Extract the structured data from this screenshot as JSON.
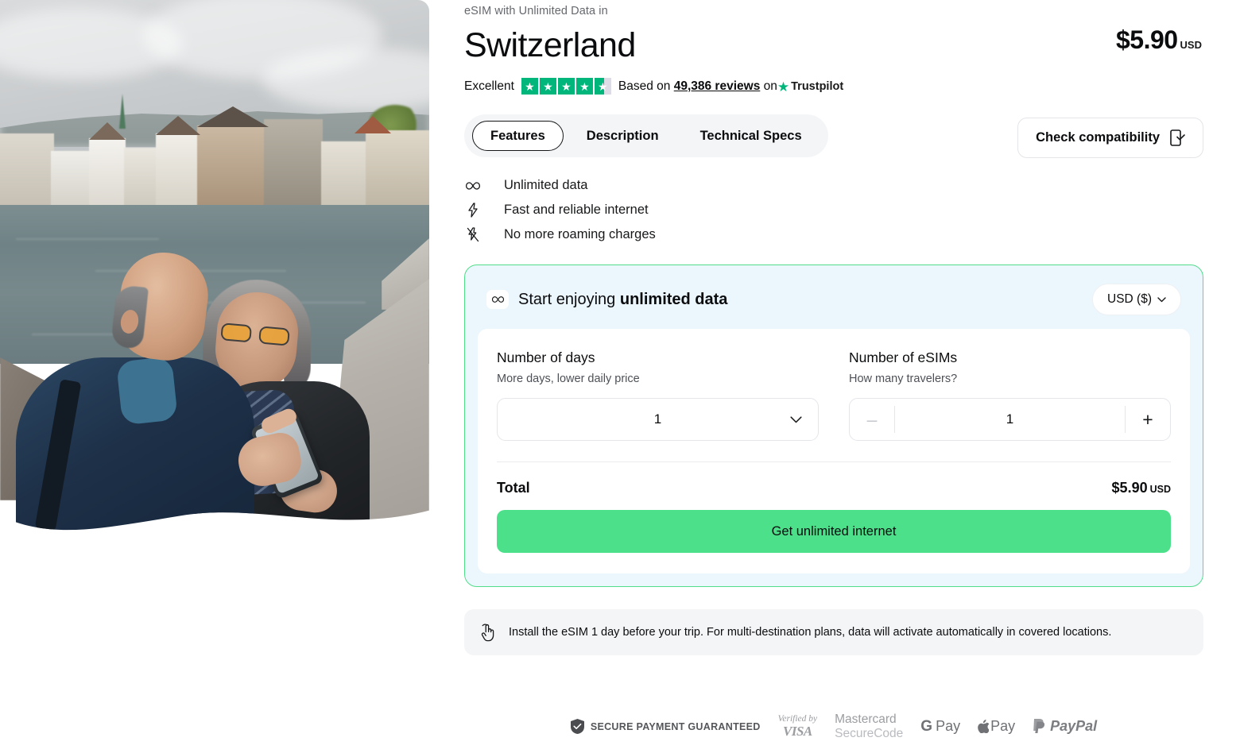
{
  "hero": {
    "alt": "Senior couple looking at a smartphone by the Limmat river in Zurich, Switzerland"
  },
  "header": {
    "eyebrow": "eSIM with Unlimited Data in",
    "title": "Switzerland",
    "price": "$5.90",
    "price_currency": "USD"
  },
  "rating": {
    "label": "Excellent",
    "stars_total": 5,
    "stars_filled": 4.6,
    "based_prefix": "Based on",
    "reviews": "49,386 reviews",
    "on": "on",
    "provider": "Trustpilot",
    "star_color": "#00b67a"
  },
  "tabs": [
    {
      "label": "Features",
      "active": true
    },
    {
      "label": "Description",
      "active": false
    },
    {
      "label": "Technical Specs",
      "active": false
    }
  ],
  "check_compatibility": {
    "label": "Check compatibility",
    "icon": "phone-check-icon"
  },
  "features": [
    {
      "icon": "infinity-icon",
      "label": "Unlimited data"
    },
    {
      "icon": "bolt-icon",
      "label": "Fast and reliable internet"
    },
    {
      "icon": "bolt-slash-icon",
      "label": "No more roaming charges"
    }
  ],
  "buy": {
    "heading_prefix": "Start enjoying ",
    "heading_bold": "unlimited data",
    "heading_icon": "infinity-icon",
    "currency_selected": "USD ($)",
    "border_color": "#52dd8a",
    "background_color": "#ecf6fd",
    "days": {
      "title": "Number of days",
      "subtitle": "More days, lower daily price",
      "value": "1"
    },
    "esims": {
      "title": "Number of eSIMs",
      "subtitle": "How many travelers?",
      "value": "1",
      "minus": "–",
      "plus": "+",
      "minus_disabled": true
    },
    "total_label": "Total",
    "total_price": "$5.90",
    "total_currency": "USD",
    "cta_label": "Get unlimited internet",
    "cta_color": "#4ce08a"
  },
  "notice": {
    "icon": "tap-gesture-icon",
    "text": "Install the eSIM 1 day before your trip. For multi-destination plans, data will activate automatically in covered locations."
  },
  "payments": {
    "secure_label": "SECURE PAYMENT GUARANTEED",
    "secure_icon": "shield-check-icon",
    "methods": [
      {
        "name": "visa",
        "line1": "Verified by",
        "line2": "VISA"
      },
      {
        "name": "mastercard",
        "line1": "Mastercard",
        "line2": "SecureCode"
      },
      {
        "name": "google-pay",
        "line1": "G",
        "line2": "Pay"
      },
      {
        "name": "apple-pay",
        "line1": "",
        "line2": "Pay"
      },
      {
        "name": "paypal",
        "line1": "PayPal",
        "line2": ""
      }
    ]
  }
}
